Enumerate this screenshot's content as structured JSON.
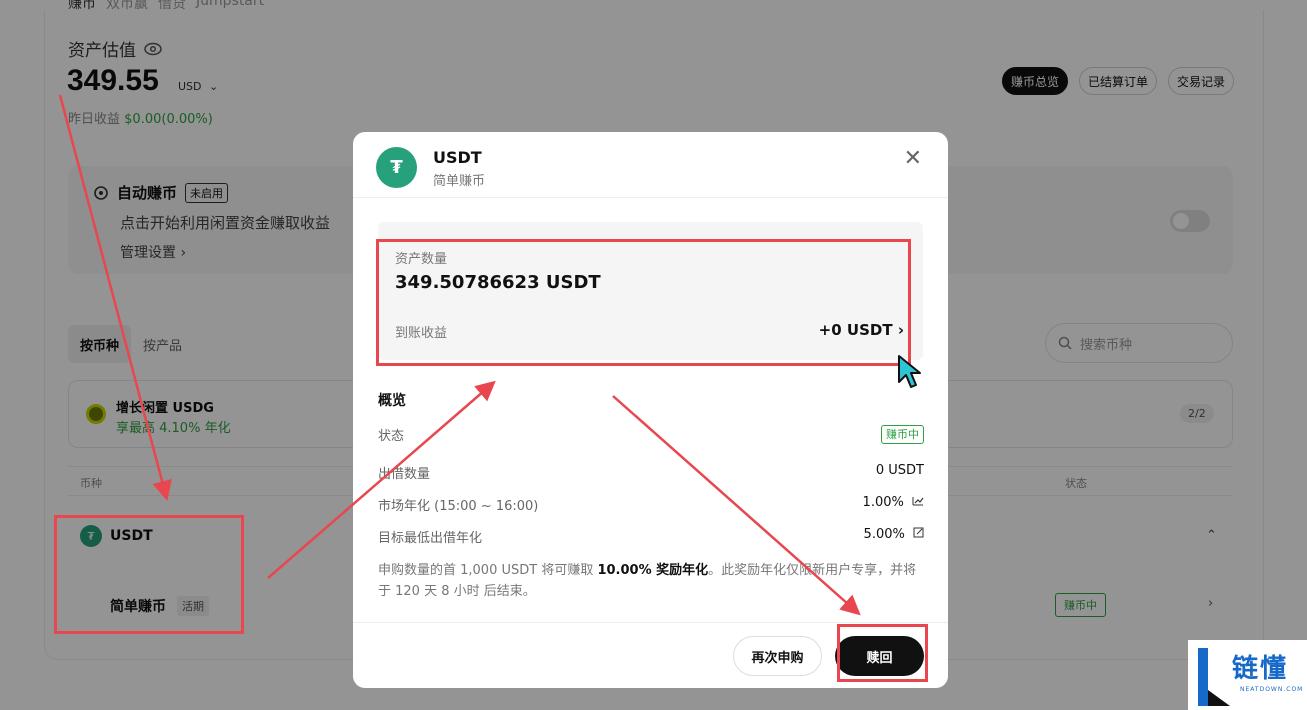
{
  "background": {
    "top_tabs": [
      "赚币",
      "双币赢",
      "借贷",
      "Jumpstart"
    ],
    "asset_title": "资产估值",
    "amount": "349.55",
    "currency": "USD",
    "yesterday_label": "昨日收益",
    "yesterday_value": "$0.00(0.00%)",
    "header_buttons": [
      "赚币总览",
      "已结算订单",
      "交易记录"
    ],
    "auto_earn": {
      "title": "自动赚币",
      "badge": "未启用",
      "desc": "点击开始利用闲置资金赚取收益",
      "manage": "管理设置 ›"
    },
    "segments": [
      "按币种",
      "按产品"
    ],
    "search_placeholder": "搜索币种",
    "promo": {
      "title": "增长闲置 USDG",
      "subtitle": "享最高 4.10% 年化",
      "count": "2/2"
    },
    "table_headers": {
      "coin": "币种",
      "status": "状态"
    },
    "row": {
      "coin": "USDT",
      "product": "简单赚币",
      "product_badge": "活期",
      "status": "赚币中"
    }
  },
  "modal": {
    "coin": "USDT",
    "product": "简单赚币",
    "asset_label": "资产数量",
    "asset_value": "349.50786623 USDT",
    "earn_label": "到账收益",
    "earn_value": "+0 USDT",
    "overview_title": "概览",
    "rows": [
      {
        "label": "状态",
        "value": "赚币中"
      },
      {
        "label": "出借数量",
        "value": "0 USDT"
      },
      {
        "label": "市场年化 (15:00 ~ 16:00)",
        "value": "1.00%"
      },
      {
        "label": "目标最低出借年化",
        "value": "5.00%"
      }
    ],
    "note_part1": "申购数量的首 1,000 USDT 将可赚取 ",
    "note_bold": "10.00% 奖励年化",
    "note_part2": "。此奖励年化仅限新用户专享，并将于 120 天 8 小时 后结束。",
    "btn_again": "再次申购",
    "btn_redeem": "赎回"
  },
  "watermark": {
    "cn": "链懂",
    "en": "NEATDOWN.COM"
  },
  "colors": {
    "accent_red": "#e8474f",
    "green": "#2ea043",
    "tether": "#26a17b"
  }
}
